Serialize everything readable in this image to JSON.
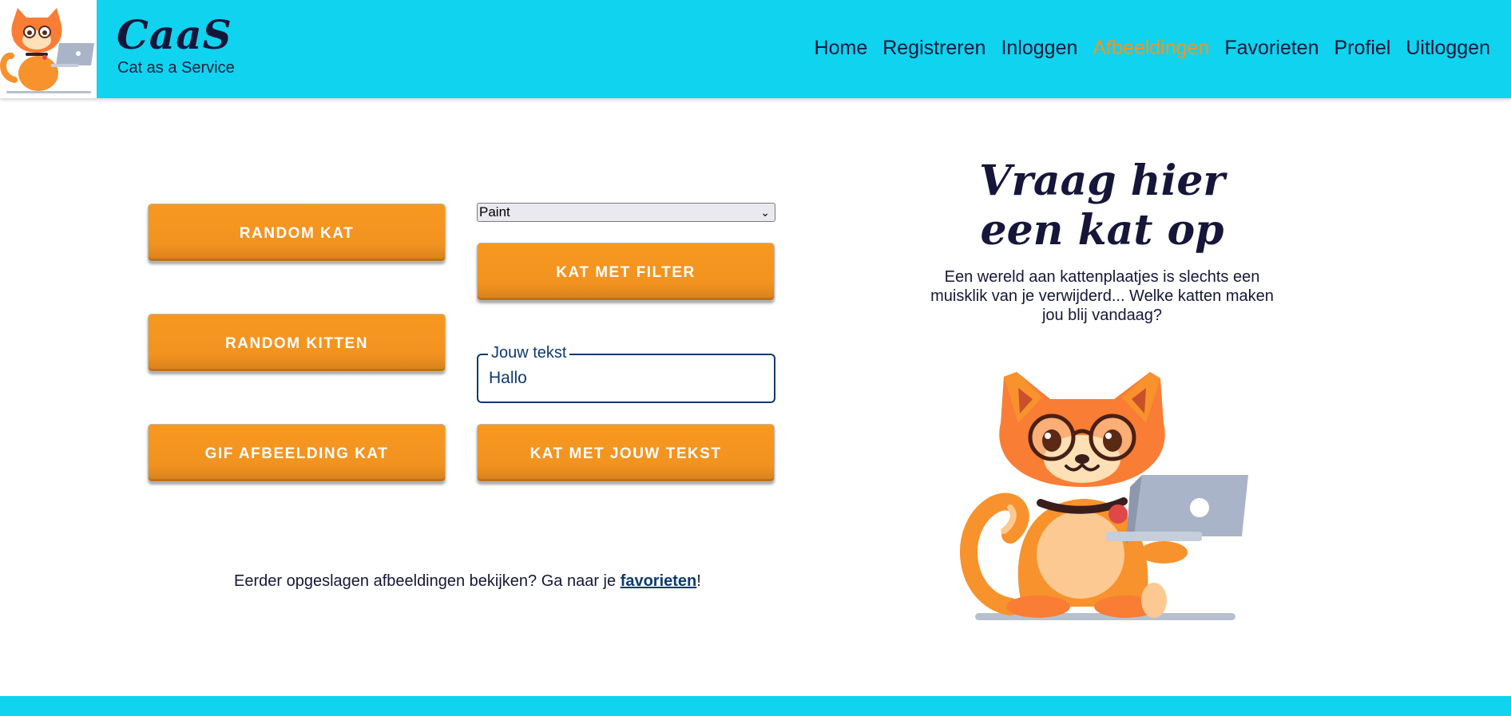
{
  "header": {
    "brand_title": "CaaS",
    "brand_subtitle": "Cat as a Service",
    "nav": [
      {
        "label": "Home"
      },
      {
        "label": "Registreren"
      },
      {
        "label": "Inloggen"
      },
      {
        "label": "Afbeeldingen",
        "active": true
      },
      {
        "label": "Favorieten"
      },
      {
        "label": "Profiel"
      },
      {
        "label": "Uitloggen"
      }
    ]
  },
  "main": {
    "buttons": {
      "random_kat": "RANDOM KAT",
      "random_kitten": "RANDOM KITTEN",
      "gif_kat": "GIF AFBEELDING KAT",
      "kat_met_filter": "KAT MET FILTER",
      "kat_met_tekst": "KAT MET JOUW TEKST"
    },
    "filter_select": {
      "selected": "Paint"
    },
    "text_field": {
      "label": "Jouw tekst",
      "value": "Hallo"
    },
    "favorites_line": {
      "prefix": "Eerder opgeslagen afbeeldingen bekijken? Ga naar je ",
      "link": "favorieten",
      "suffix": "!"
    },
    "hero": {
      "title_line1": "Vraag hier",
      "title_line2": "een kat op",
      "text": "Een wereld aan kattenplaatjes is slechts een muisklik van je verwijderd... Welke katten maken jou blij vandaag?"
    }
  },
  "colors": {
    "header_bg": "#0fd3ef",
    "accent_orange": "#f7941d",
    "navy": "#16163a",
    "link_blue": "#0d3a70"
  },
  "icons": [
    "cat-logo-icon",
    "cat-laptop-illustration",
    "chevron-down-icon"
  ]
}
